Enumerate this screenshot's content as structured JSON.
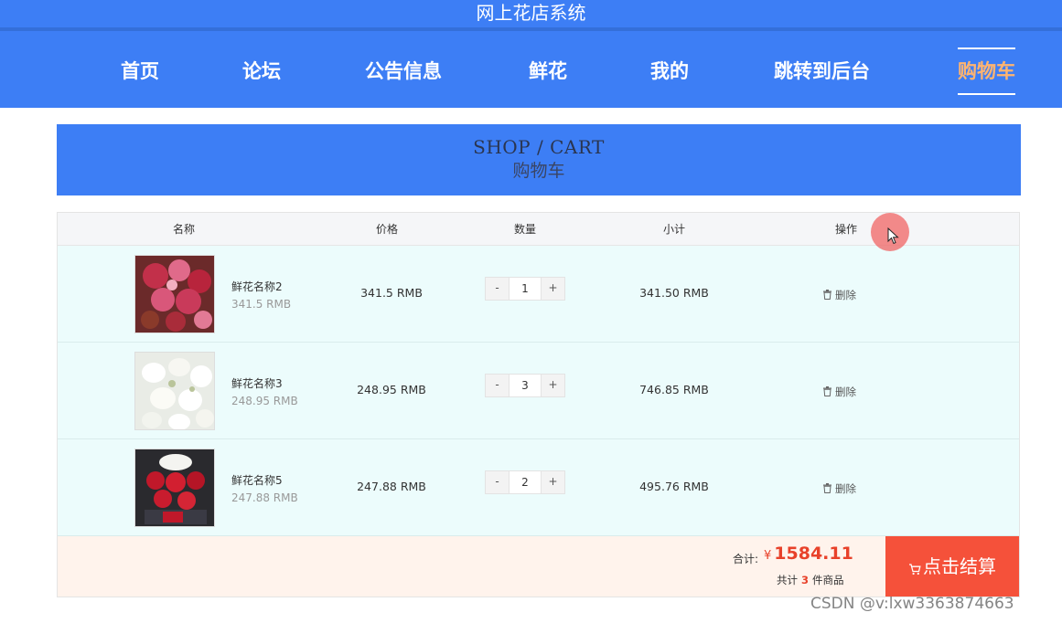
{
  "site": {
    "title": "网上花店系统"
  },
  "nav": {
    "items": [
      {
        "label": "首页"
      },
      {
        "label": "论坛"
      },
      {
        "label": "公告信息"
      },
      {
        "label": "鲜花"
      },
      {
        "label": "我的"
      },
      {
        "label": "跳转到后台"
      },
      {
        "label": "购物车",
        "active": true
      }
    ]
  },
  "banner": {
    "en": "SHOP / CART",
    "zh": "购物车"
  },
  "table": {
    "headers": {
      "name": "名称",
      "price": "价格",
      "qty": "数量",
      "subtotal": "小计",
      "action": "操作"
    },
    "rows": [
      {
        "name": "鲜花名称2",
        "sub_price": "341.5 RMB",
        "price": "341.5 RMB",
        "qty": "1",
        "subtotal": "341.50 RMB",
        "delete": "删除",
        "image": "red-pink-bouquet"
      },
      {
        "name": "鲜花名称3",
        "sub_price": "248.95 RMB",
        "price": "248.95 RMB",
        "qty": "3",
        "subtotal": "746.85 RMB",
        "delete": "删除",
        "image": "white-lily-bouquet"
      },
      {
        "name": "鲜花名称5",
        "sub_price": "247.88 RMB",
        "price": "247.88 RMB",
        "qty": "2",
        "subtotal": "495.76 RMB",
        "delete": "删除",
        "image": "red-rose-dark-bouquet"
      }
    ],
    "minus": "-",
    "plus": "+"
  },
  "summary": {
    "total_label": "合计:",
    "currency": "¥",
    "total": "1584.11",
    "count_prefix": "共计",
    "count": "3",
    "count_suffix": "件商品",
    "checkout_label": "点击结算"
  },
  "colors": {
    "primary": "#3d7ef5",
    "active_nav": "#ffb470",
    "accent": "#f5513a",
    "row_bg": "#ecfcfc",
    "footer_bg": "#fff3ec"
  },
  "watermark": "CSDN @v:lxw3363874663"
}
